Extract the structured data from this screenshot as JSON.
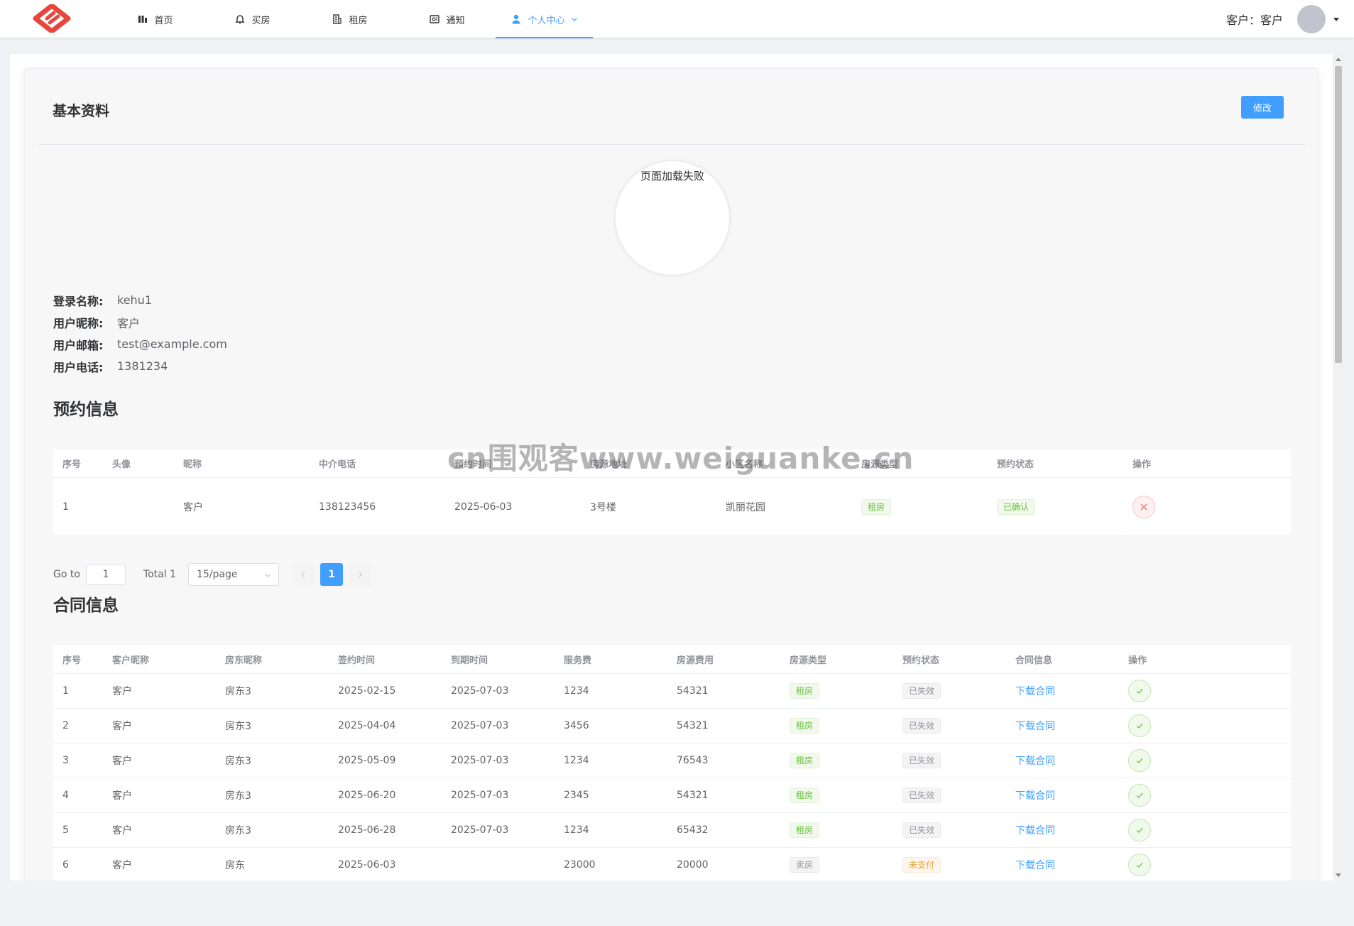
{
  "nav": {
    "items": [
      {
        "label": "首页",
        "icon": "chart-bar-icon"
      },
      {
        "label": "买房",
        "icon": "bell-icon"
      },
      {
        "label": "租房",
        "icon": "building-icon"
      },
      {
        "label": "通知",
        "icon": "notification-icon"
      },
      {
        "label": "个人中心",
        "icon": "user-icon"
      }
    ],
    "active_index": 4,
    "user_text": "客户：客户"
  },
  "profile": {
    "title": "基本资料",
    "edit_label": "修改",
    "avatar_error": "页面加载失败",
    "fields": [
      {
        "label": "登录名称:",
        "value": "kehu1"
      },
      {
        "label": "用户昵称:",
        "value": "客户"
      },
      {
        "label": "用户邮箱:",
        "value": "test@example.com"
      },
      {
        "label": "用户电话:",
        "value": "1381234"
      }
    ]
  },
  "appointments": {
    "title": "预约信息",
    "columns": [
      "序号",
      "头像",
      "昵称",
      "中介电话",
      "预约时间",
      "房源地址",
      "小区名称",
      "房源类型",
      "预约状态",
      "操作"
    ],
    "rows": [
      {
        "index": "1",
        "avatar": "",
        "nickname": "客户",
        "phone": "138123456",
        "time": "2025-06-03",
        "address": "3号楼",
        "community": "凯丽花园",
        "type": "租房",
        "status": "已确认"
      }
    ]
  },
  "pagination": {
    "goto_label": "Go to",
    "goto_value": "1",
    "total_label": "Total 1",
    "page_size": "15/page",
    "current_page": "1"
  },
  "contracts": {
    "title": "合同信息",
    "columns": [
      "序号",
      "客户昵称",
      "房东昵称",
      "签约时间",
      "到期时间",
      "服务费",
      "房源费用",
      "房源类型",
      "预约状态",
      "合同信息",
      "操作"
    ],
    "download_label": "下载合同",
    "rows": [
      {
        "index": "1",
        "customer": "客户",
        "landlord": "房东3",
        "sign": "2025-02-15",
        "expire": "2025-07-03",
        "fee": "1234",
        "price": "54321",
        "type": "租房",
        "type_color": "green",
        "status": "已失效",
        "status_color": "gray"
      },
      {
        "index": "2",
        "customer": "客户",
        "landlord": "房东3",
        "sign": "2025-04-04",
        "expire": "2025-07-03",
        "fee": "3456",
        "price": "54321",
        "type": "租房",
        "type_color": "green",
        "status": "已失效",
        "status_color": "gray"
      },
      {
        "index": "3",
        "customer": "客户",
        "landlord": "房东3",
        "sign": "2025-05-09",
        "expire": "2025-07-03",
        "fee": "1234",
        "price": "76543",
        "type": "租房",
        "type_color": "green",
        "status": "已失效",
        "status_color": "gray"
      },
      {
        "index": "4",
        "customer": "客户",
        "landlord": "房东3",
        "sign": "2025-06-20",
        "expire": "2025-07-03",
        "fee": "2345",
        "price": "54321",
        "type": "租房",
        "type_color": "green",
        "status": "已失效",
        "status_color": "gray"
      },
      {
        "index": "5",
        "customer": "客户",
        "landlord": "房东3",
        "sign": "2025-06-28",
        "expire": "2025-07-03",
        "fee": "1234",
        "price": "65432",
        "type": "租房",
        "type_color": "green",
        "status": "已失效",
        "status_color": "gray"
      },
      {
        "index": "6",
        "customer": "客户",
        "landlord": "房东",
        "sign": "2025-06-03",
        "expire": "",
        "fee": "23000",
        "price": "20000",
        "type": "卖房",
        "type_color": "gray",
        "status": "未支付",
        "status_color": "orange"
      }
    ]
  },
  "watermark": "cn围观客www.weiguanke.cn",
  "colors": {
    "primary": "#409eff",
    "success": "#67c23a",
    "danger": "#f56c6c",
    "warning": "#e6a23c",
    "logo": "#e8453c"
  }
}
